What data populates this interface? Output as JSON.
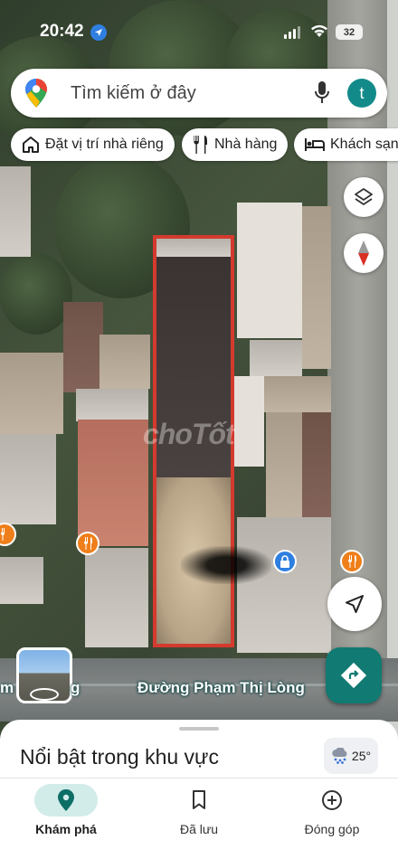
{
  "status_bar": {
    "time": "20:42",
    "battery": "32"
  },
  "search": {
    "placeholder": "Tìm kiếm ở đây",
    "avatar_letter": "t"
  },
  "chips": [
    {
      "label": "Đặt vị trí nhà riêng",
      "icon": "home-icon"
    },
    {
      "label": "Nhà hàng",
      "icon": "restaurant-icon"
    },
    {
      "label": "Khách sạn",
      "icon": "hotel-icon"
    }
  ],
  "map": {
    "watermark": "choTốt",
    "street_name": "Đường Phạm Thị Lòng",
    "street_fragment_left": "m",
    "street_fragment_left2": "g",
    "selection_color": "#d43a2e"
  },
  "bottom_sheet": {
    "title": "Nổi bật trong khu vực",
    "weather_temp": "25°",
    "weather_icon": "rain-cloud-icon"
  },
  "nav": {
    "items": [
      {
        "label": "Khám phá",
        "icon": "explore-pin-icon",
        "active": true
      },
      {
        "label": "Đã lưu",
        "icon": "bookmark-icon",
        "active": false
      },
      {
        "label": "Đóng góp",
        "icon": "add-circle-icon",
        "active": false
      }
    ]
  },
  "colors": {
    "accent": "#117a72",
    "active_nav_bg": "#d2ecea",
    "poi_orange": "#ef7f1a",
    "poi_blue": "#2f7fe0"
  }
}
